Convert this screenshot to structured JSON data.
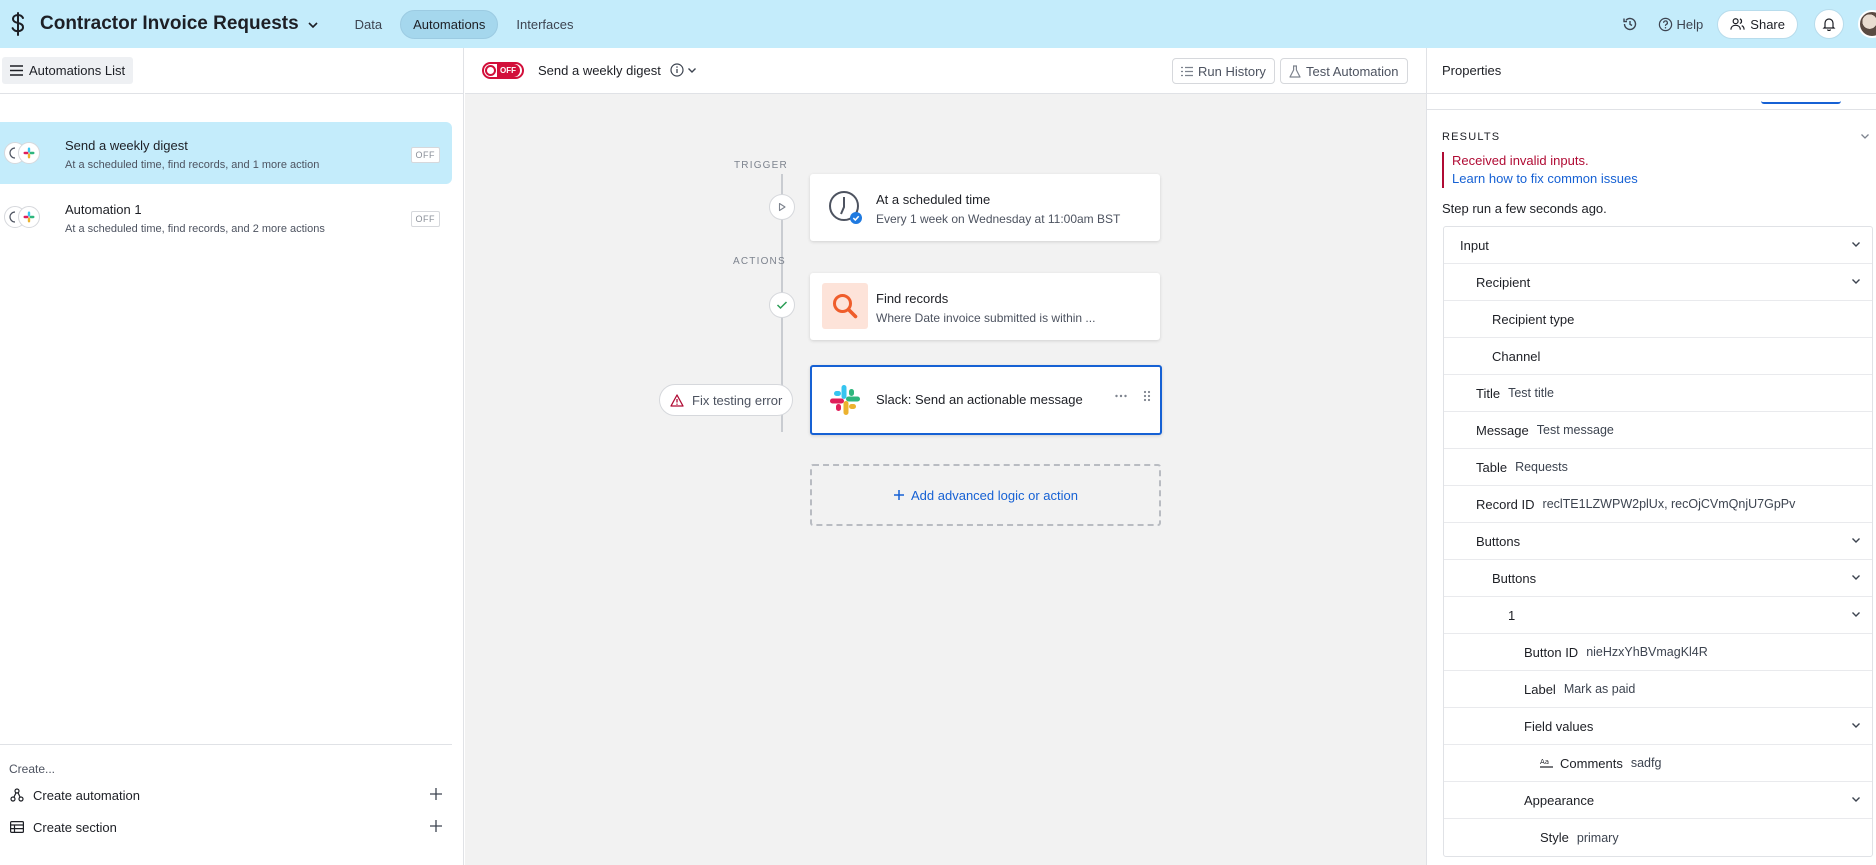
{
  "topbar": {
    "title": "Contractor Invoice Requests",
    "tabs": [
      {
        "label": "Data",
        "active": false
      },
      {
        "label": "Automations",
        "active": true
      },
      {
        "label": "Interfaces",
        "active": false
      }
    ],
    "help_label": "Help",
    "share_label": "Share"
  },
  "sidebar": {
    "list_button": "Automations List",
    "automations": [
      {
        "name": "Send a weekly digest",
        "desc": "At a scheduled time, find records, and 1 more action",
        "status": "OFF",
        "selected": true
      },
      {
        "name": "Automation 1",
        "desc": "At a scheduled time, find records, and 2 more actions",
        "status": "OFF",
        "selected": false
      }
    ],
    "create_label": "Create...",
    "create_automation": "Create automation",
    "create_section": "Create section"
  },
  "canvas": {
    "toggle_label": "OFF",
    "automation_title": "Send a weekly digest",
    "run_history": "Run History",
    "test_automation": "Test Automation",
    "trigger_label": "TRIGGER",
    "actions_label": "ACTIONS",
    "trigger_card": {
      "title": "At a scheduled time",
      "sub": "Every 1 week on Wednesday at 11:00am BST"
    },
    "find_card": {
      "title": "Find records",
      "sub": "Where Date invoice submitted is within ..."
    },
    "slack_card": {
      "title": "Slack: Send an actionable message"
    },
    "fix_error": "Fix testing error",
    "add_logic": "Add advanced logic or action"
  },
  "properties": {
    "header": "Properties",
    "results_label": "RESULTS",
    "error_text": "Received invalid inputs.",
    "error_link": "Learn how to fix common issues",
    "run_text": "Step run a few seconds ago.",
    "tree": [
      {
        "key": "Input",
        "value": "",
        "indent": 0,
        "expandable": true
      },
      {
        "key": "Recipient",
        "value": "",
        "indent": 1,
        "expandable": true
      },
      {
        "key": "Recipient type",
        "value": "",
        "indent": 2,
        "expandable": false
      },
      {
        "key": "Channel",
        "value": "",
        "indent": 2,
        "expandable": false
      },
      {
        "key": "Title",
        "value": "Test title",
        "indent": 1,
        "expandable": false
      },
      {
        "key": "Message",
        "value": "Test message",
        "indent": 1,
        "expandable": false
      },
      {
        "key": "Table",
        "value": "Requests",
        "indent": 1,
        "expandable": false
      },
      {
        "key": "Record ID",
        "value": "reclTE1LZWPW2plUx, recOjCVmQnjU7GpPv",
        "indent": 1,
        "expandable": false
      },
      {
        "key": "Buttons",
        "value": "",
        "indent": 1,
        "expandable": true
      },
      {
        "key": "Buttons",
        "value": "",
        "indent": 2,
        "expandable": true
      },
      {
        "key": "1",
        "value": "",
        "indent": 3,
        "expandable": true
      },
      {
        "key": "Button ID",
        "value": "nieHzxYhBVmagKl4R",
        "indent": 4,
        "expandable": false
      },
      {
        "key": "Label",
        "value": "Mark as paid",
        "indent": 4,
        "expandable": false
      },
      {
        "key": "Field values",
        "value": "",
        "indent": 4,
        "expandable": true
      },
      {
        "key": "Comments",
        "value": "sadfg",
        "indent": 5,
        "expandable": false,
        "icon": "text-field-icon"
      },
      {
        "key": "Appearance",
        "value": "",
        "indent": 4,
        "expandable": true
      },
      {
        "key": "Style",
        "value": "primary",
        "indent": 5,
        "expandable": false
      }
    ]
  },
  "colors": {
    "topbar_bg": "#c4ecfb",
    "selected_bg": "#c4ecfb",
    "error_red": "#b00b34",
    "link_blue": "#1661d4",
    "toggle_red": "#d20f3a"
  }
}
